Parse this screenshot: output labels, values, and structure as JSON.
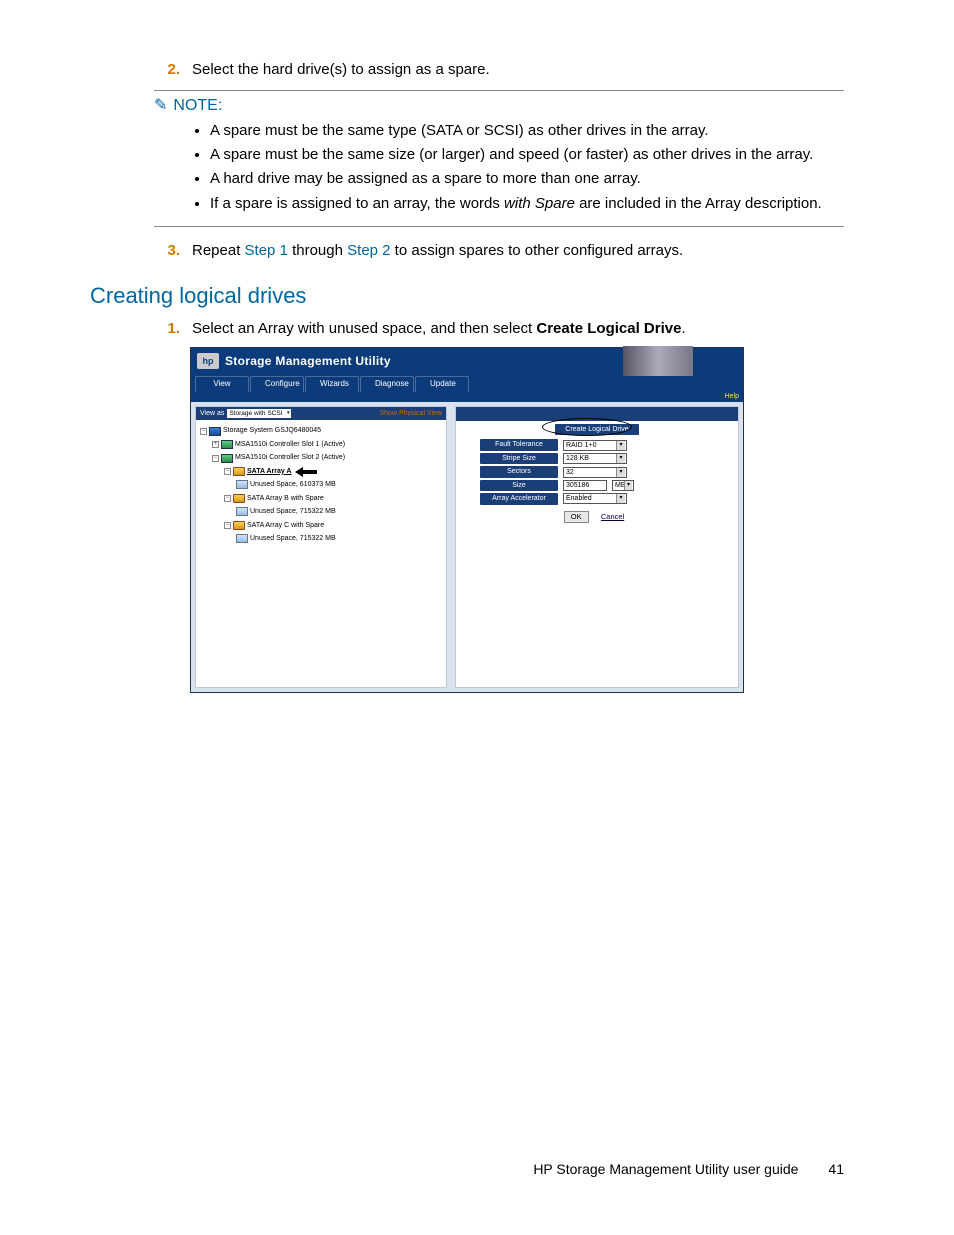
{
  "steps": {
    "s2_num": "2.",
    "s2_text": "Select the hard drive(s) to assign as a spare.",
    "s3_num": "3.",
    "s3_pre": "Repeat ",
    "s3_link1": "Step 1",
    "s3_mid": " through ",
    "s3_link2": "Step 2",
    "s3_post": " to assign spares to other configured arrays."
  },
  "note": {
    "label": "NOTE:",
    "b1": "A spare must be the same type (SATA or SCSI) as other drives in the array.",
    "b2": "A spare must be the same size (or larger) and speed (or faster) as other drives in the array.",
    "b3": "A hard drive may be assigned as a spare to more than one array.",
    "b4a": "If a spare is assigned to an array, the words ",
    "b4i": "with Spare",
    "b4b": " are included in the Array description."
  },
  "section": {
    "heading": "Creating logical drives",
    "s1_num": "1.",
    "s1_a": "Select an Array with unused space, and then select ",
    "s1_b": "Create Logical Drive",
    "s1_c": "."
  },
  "app": {
    "logo": "hp",
    "title": "Storage Management Utility",
    "tabs": {
      "view": "View",
      "configure": "Configure",
      "wizards": "Wizards",
      "diagnose": "Diagnose",
      "update": "Update"
    },
    "help": "Help",
    "viewas_label": "View as",
    "viewas_value": "Storage with SCSI",
    "show_physical": "Show Physical View",
    "tree": {
      "sys": "Storage System GSJQ6480045",
      "ctrl1": "MSA1510i Controller Slot 1 (Active)",
      "ctrl2": "MSA1510i Controller Slot 2 (Active)",
      "arrA": "SATA Array A",
      "arrA_sp": "Unused Space, 610373 MB",
      "arrB": "SATA Array B with Spare",
      "arrB_sp": "Unused Space, 715322 MB",
      "arrC": "SATA Array C with Spare",
      "arrC_sp": "Unused Space, 715322 MB"
    },
    "right": {
      "create_btn": "Create Logical Drive",
      "ft_label": "Fault Tolerance",
      "ft_val": "RAID 1+0",
      "ss_label": "Stripe Size",
      "ss_val": "128 KB",
      "sec_label": "Sectors",
      "sec_val": "32",
      "sz_label": "Size",
      "sz_val": "305186",
      "sz_unit": "MB",
      "aa_label": "Array Accelerator",
      "aa_val": "Enabled",
      "ok": "OK",
      "cancel": "Cancel"
    }
  },
  "footer": {
    "title": "HP Storage Management Utility user guide",
    "page": "41"
  }
}
